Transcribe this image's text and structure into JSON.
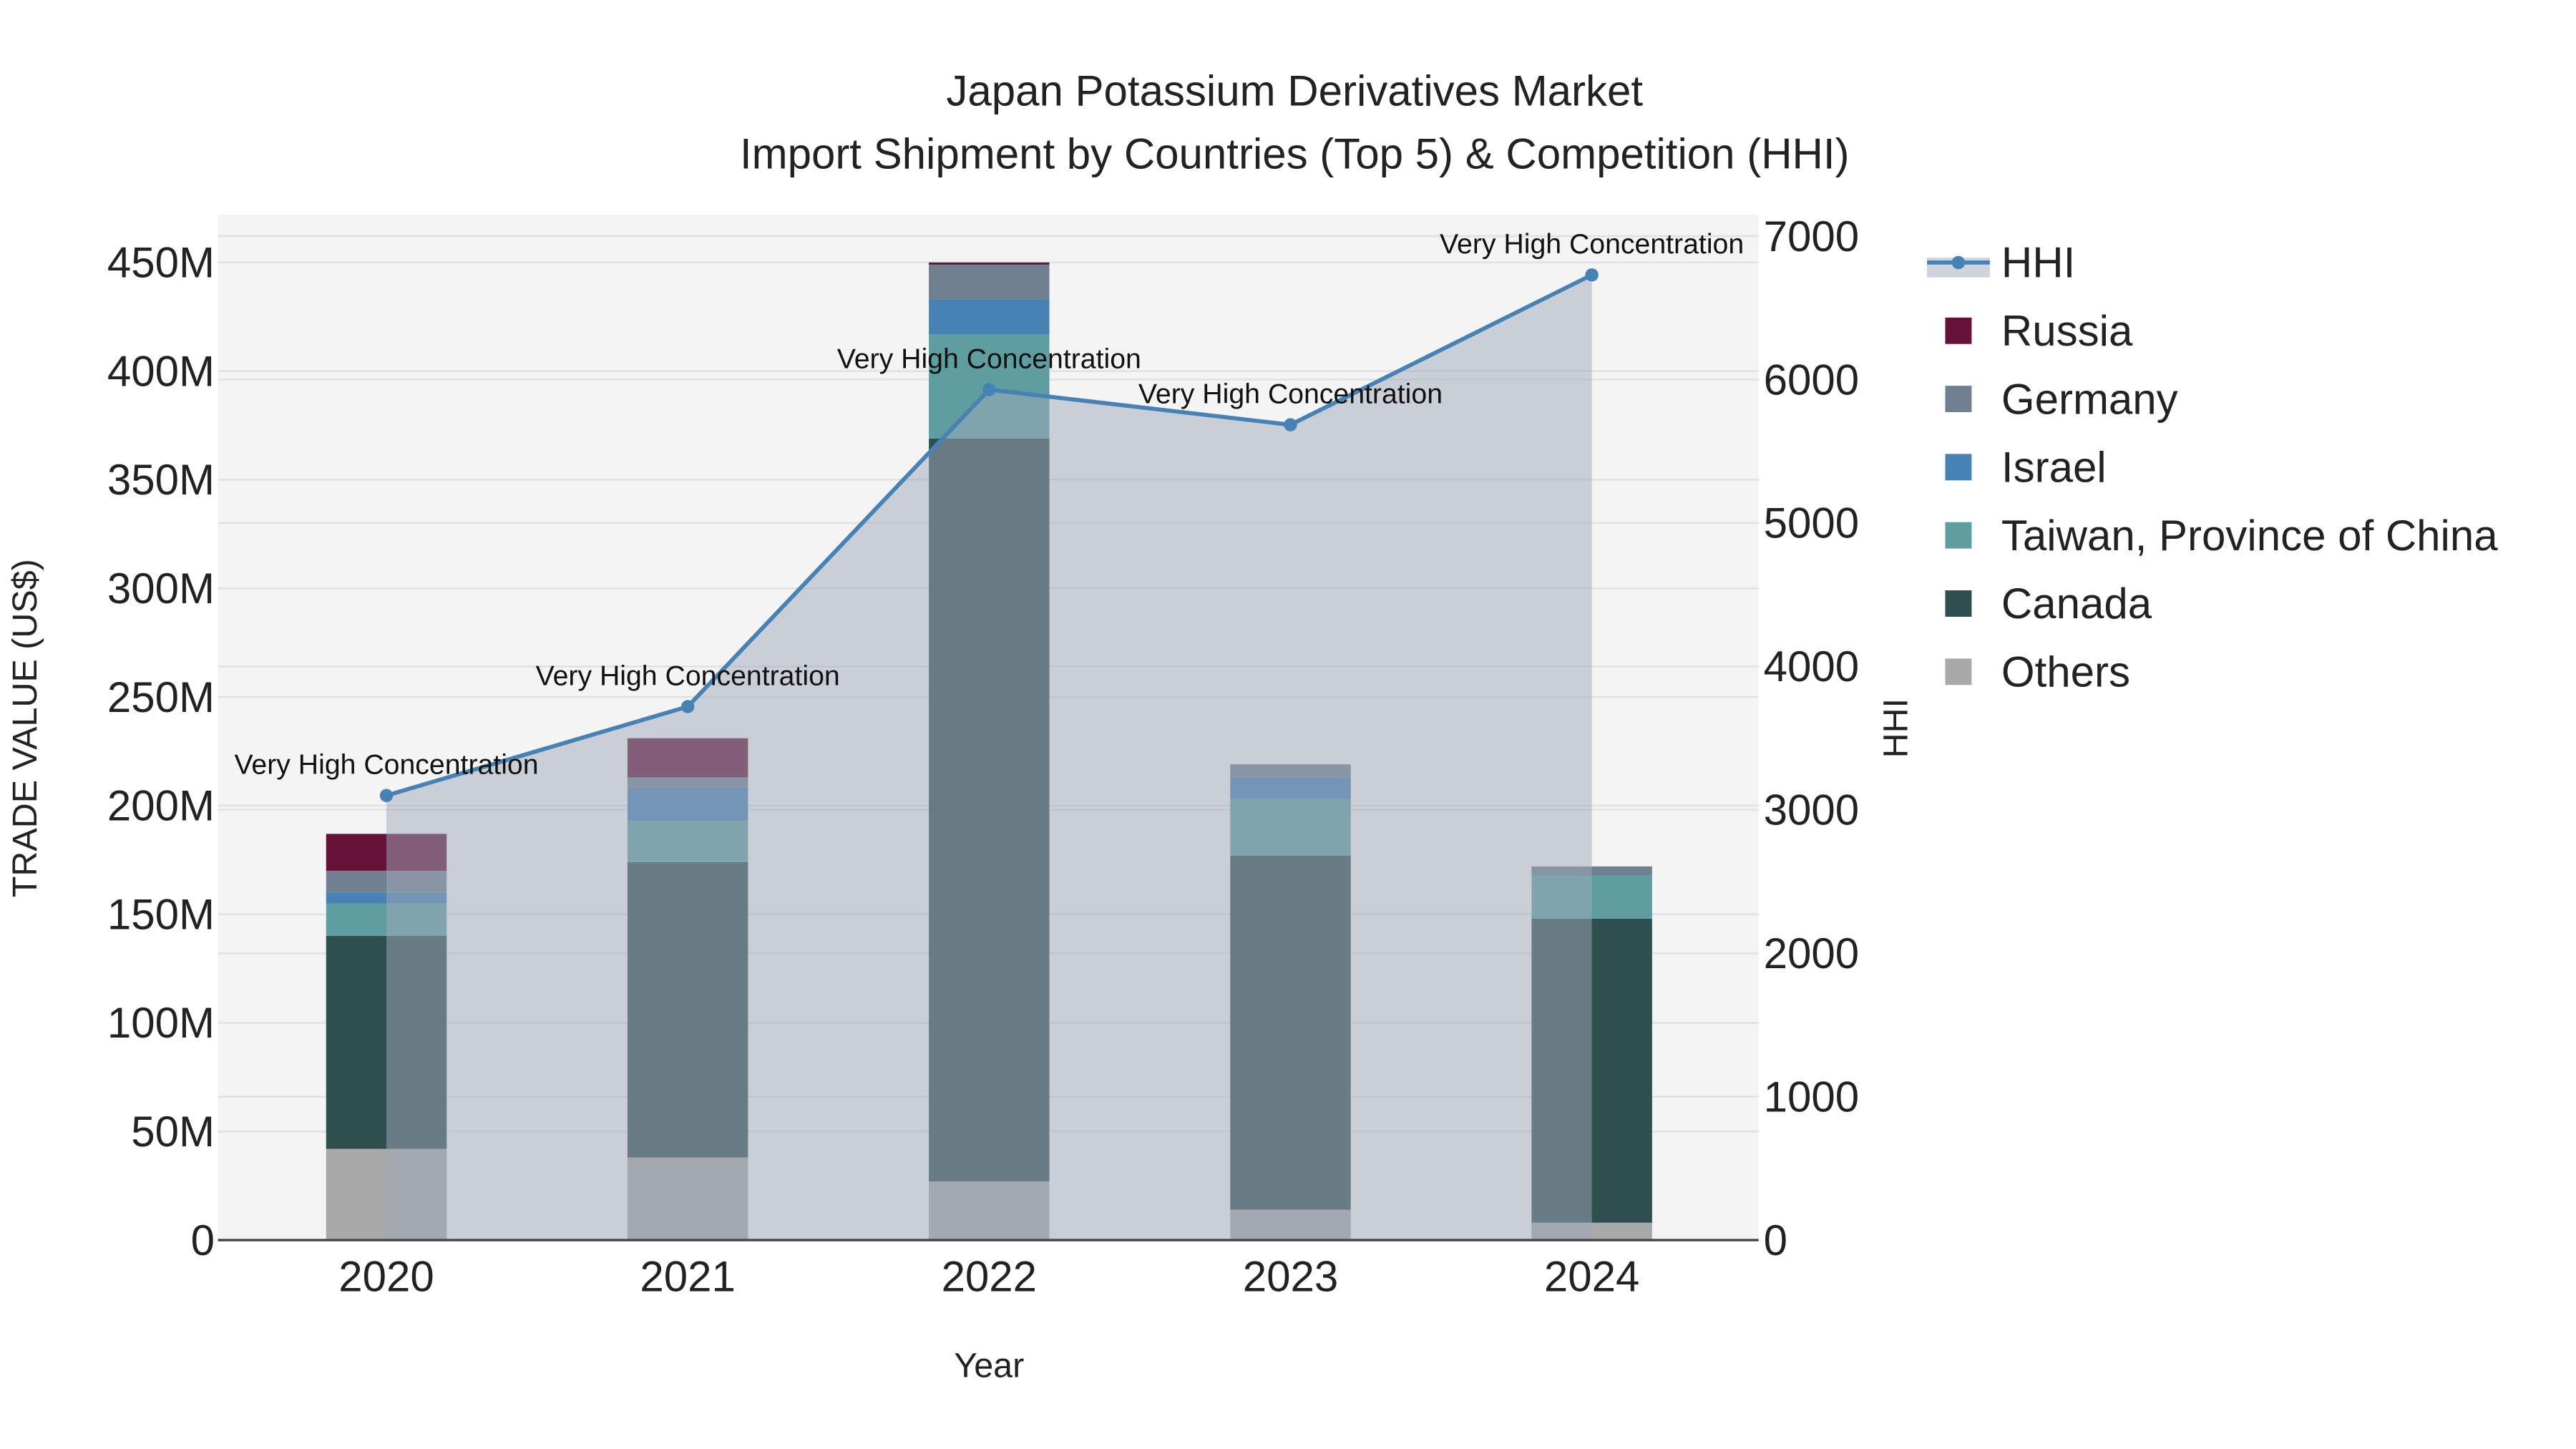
{
  "chart_data": {
    "type": "bar",
    "title": "Japan Potassium Derivatives Market",
    "subtitle": "Import Shipment by Countries (Top 5) & Competition (HHI)",
    "xlabel": "Year",
    "ylabel": "TRADE VALUE (US$)",
    "y2label": "HHI",
    "categories": [
      "2020",
      "2021",
      "2022",
      "2023",
      "2024"
    ],
    "ylim": [
      0,
      472
    ],
    "y_unit": "M",
    "yticks": [
      0,
      50,
      100,
      150,
      200,
      250,
      300,
      350,
      400,
      450
    ],
    "ytick_labels": [
      "0",
      "50M",
      "100M",
      "150M",
      "200M",
      "250M",
      "300M",
      "350M",
      "400M",
      "450M"
    ],
    "y2lim": [
      0,
      7150
    ],
    "y2ticks": [
      0,
      1000,
      2000,
      3000,
      4000,
      5000,
      6000,
      7000
    ],
    "y2tick_labels": [
      "0",
      "1000",
      "2000",
      "3000",
      "4000",
      "5000",
      "6000",
      "7000"
    ],
    "series": [
      {
        "name": "Others",
        "color": "#a9a9a9",
        "values": [
          42,
          38,
          27,
          14,
          8
        ]
      },
      {
        "name": "Canada",
        "color": "#2f4f4f",
        "values": [
          98,
          136,
          342,
          163,
          140
        ]
      },
      {
        "name": "Taiwan, Province of China",
        "color": "#5f9ea0",
        "values": [
          15,
          19,
          48,
          26,
          20
        ]
      },
      {
        "name": "Israel",
        "color": "#4682b4",
        "values": [
          5,
          15,
          16,
          10,
          0
        ]
      },
      {
        "name": "Germany",
        "color": "#708090",
        "values": [
          10,
          5,
          16,
          6,
          4
        ]
      },
      {
        "name": "Russia",
        "color": "#651236",
        "values": [
          17,
          18,
          1,
          0,
          0
        ]
      }
    ],
    "hhi": {
      "name": "HHI",
      "color": "#4682b4",
      "values": [
        3100,
        3720,
        5930,
        5685,
        6730
      ],
      "annotations": [
        "Very High Concentration",
        "Very High Concentration",
        "Very High Concentration",
        "Very High Concentration",
        "Very High Concentration"
      ]
    },
    "legend": [
      "HHI",
      "Russia",
      "Germany",
      "Israel",
      "Taiwan, Province of China",
      "Canada",
      "Others"
    ],
    "legend_position": "right",
    "grid": true
  }
}
